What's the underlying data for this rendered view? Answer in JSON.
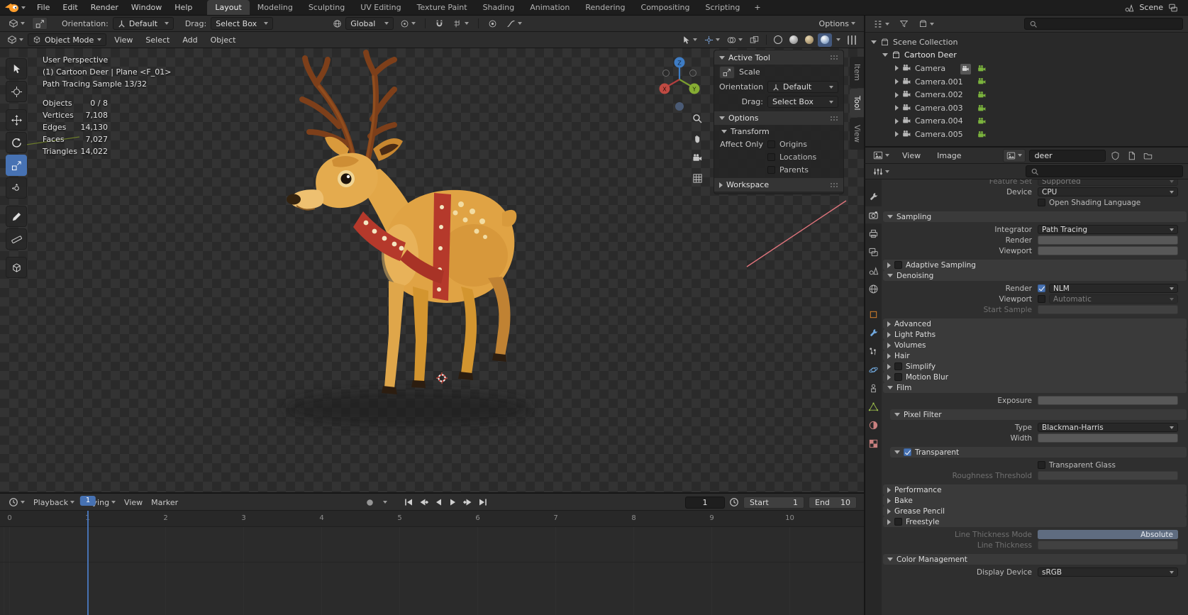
{
  "colors": {
    "accent": "#4772b3",
    "deer_body": "#e0a344",
    "harness_red": "#b5392b"
  },
  "topbar": {
    "menus": [
      "File",
      "Edit",
      "Render",
      "Window",
      "Help"
    ],
    "workspaces": [
      {
        "label": "Layout",
        "active": true
      },
      {
        "label": "Modeling"
      },
      {
        "label": "Sculpting"
      },
      {
        "label": "UV Editing"
      },
      {
        "label": "Texture Paint"
      },
      {
        "label": "Shading"
      },
      {
        "label": "Animation"
      },
      {
        "label": "Rendering"
      },
      {
        "label": "Compositing"
      },
      {
        "label": "Scripting"
      }
    ],
    "add_workspace": "+",
    "scene_name": "Scene"
  },
  "tool_settings": {
    "orientation_label": "Orientation:",
    "orientation_value": "Default",
    "drag_label": "Drag:",
    "drag_value": "Select Box",
    "pivot_value": "Global",
    "options_label": "Options"
  },
  "viewport": {
    "mode": "Object Mode",
    "menus": [
      "View",
      "Select",
      "Add",
      "Object"
    ],
    "overlay": {
      "line1": "User Perspective",
      "line2": "(1) Cartoon Deer | Plane <F_01>",
      "line3": "Path Tracing Sample 13/32",
      "stats": [
        {
          "label": "Objects",
          "value": "0 / 8"
        },
        {
          "label": "Vertices",
          "value": "7,108"
        },
        {
          "label": "Edges",
          "value": "14,130"
        },
        {
          "label": "Faces",
          "value": "7,027"
        },
        {
          "label": "Triangles",
          "value": "14,022"
        }
      ]
    },
    "axis_labels": {
      "x": "X",
      "y": "Y",
      "z": "Z"
    },
    "side_tabs": [
      "Item",
      "Tool",
      "View"
    ]
  },
  "tool_panel": {
    "active_tool_title": "Active Tool",
    "tool_name": "Scale",
    "orientation_label": "Orientation",
    "orientation_value": "Default",
    "drag_label": "Drag:",
    "drag_value": "Select Box",
    "options_title": "Options",
    "transform_title": "Transform",
    "affect_only_label": "Affect Only",
    "affect_options": [
      "Origins",
      "Locations",
      "Parents"
    ],
    "workspace_title": "Workspace"
  },
  "timeline": {
    "menus": [
      "Playback",
      "Keying",
      "View",
      "Marker"
    ],
    "current_frame": "1",
    "start_label": "Start",
    "start_value": "1",
    "end_label": "End",
    "end_value": "10",
    "ticks": [
      "0",
      "1",
      "2",
      "3",
      "4",
      "5",
      "6",
      "7",
      "8",
      "9",
      "10"
    ]
  },
  "outliner": {
    "root_label": "Scene Collection",
    "collection_label": "Cartoon Deer",
    "cameras": [
      "Camera",
      "Camera.001",
      "Camera.002",
      "Camera.003",
      "Camera.004",
      "Camera.005"
    ]
  },
  "image_editor": {
    "menus": [
      "View",
      "Image"
    ],
    "image_name": "deer"
  },
  "properties": {
    "feature_set_label": "Feature Set",
    "feature_set_value": "Supported",
    "device_label": "Device",
    "device_value": "CPU",
    "osl_label": "Open Shading Language",
    "sampling": {
      "title": "Sampling",
      "integrator_label": "Integrator",
      "integrator_value": "Path Tracing",
      "render_label": "Render",
      "viewport_label": "Viewport"
    },
    "adaptive_sampling_title": "Adaptive Sampling",
    "denoising": {
      "title": "Denoising",
      "render_label": "Render",
      "render_value": "NLM",
      "viewport_label": "Viewport",
      "viewport_value": "Automatic",
      "start_sample_label": "Start Sample"
    },
    "advanced_title": "Advanced",
    "light_paths_title": "Light Paths",
    "volumes_title": "Volumes",
    "hair_title": "Hair",
    "simplify_title": "Simplify",
    "motion_blur_title": "Motion Blur",
    "film": {
      "title": "Film",
      "exposure_label": "Exposure",
      "pixel_filter_title": "Pixel Filter",
      "type_label": "Type",
      "type_value": "Blackman-Harris",
      "width_label": "Width",
      "transparent_title": "Transparent",
      "transparent_glass_label": "Transparent Glass",
      "roughness_label": "Roughness Threshold"
    },
    "performance_title": "Performance",
    "bake_title": "Bake",
    "grease_pencil_title": "Grease Pencil",
    "freestyle": {
      "title": "Freestyle",
      "line_thickness_mode_label": "Line Thickness Mode",
      "line_thickness_mode_value": "Absolute",
      "line_thickness_label": "Line Thickness"
    },
    "color_management": {
      "title": "Color Management",
      "display_device_label": "Display Device",
      "display_device_value": "sRGB"
    }
  }
}
